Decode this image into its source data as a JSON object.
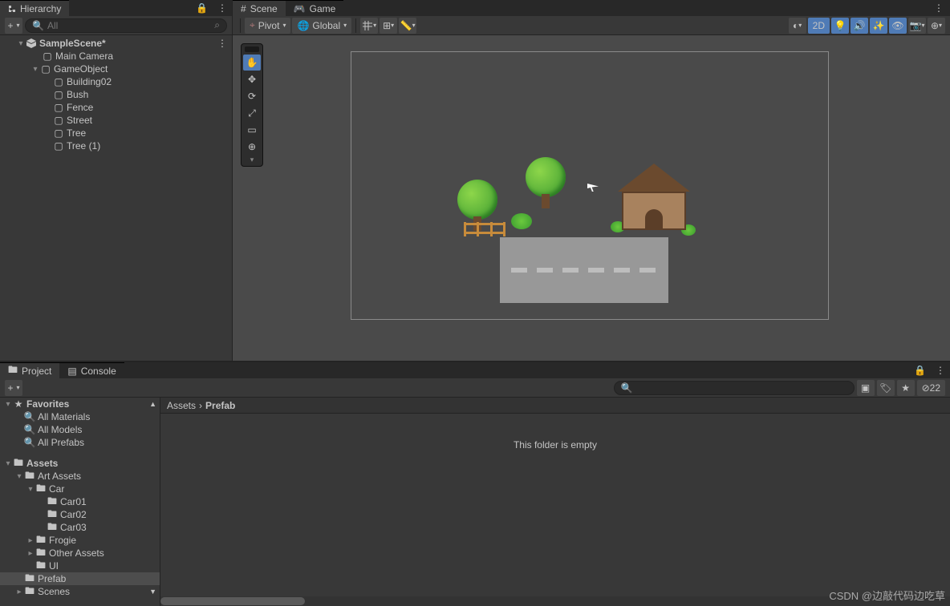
{
  "hierarchy": {
    "tab": "Hierarchy",
    "search_placeholder": "All",
    "scene": "SampleScene*",
    "items": [
      "Main Camera",
      "GameObject",
      "Building02",
      "Bush",
      "Fence",
      "Street",
      "Tree",
      "Tree (1)"
    ]
  },
  "scene": {
    "tab_scene": "Scene",
    "tab_game": "Game",
    "pivot": "Pivot",
    "global": "Global",
    "btn_2d": "2D"
  },
  "project": {
    "tab_project": "Project",
    "tab_console": "Console",
    "hidden_count": "22",
    "favorites": {
      "title": "Favorites",
      "items": [
        "All Materials",
        "All Models",
        "All Prefabs"
      ]
    },
    "assets": {
      "title": "Assets",
      "art": "Art Assets",
      "car": "Car",
      "cars": [
        "Car01",
        "Car02",
        "Car03"
      ],
      "frogie": "Frogie",
      "other": "Other Assets",
      "ui": "UI",
      "prefab": "Prefab",
      "scenes": "Scenes"
    },
    "breadcrumb": {
      "root": "Assets",
      "sub": "Prefab"
    },
    "empty": "This folder is empty"
  },
  "watermark": "CSDN @边敲代码边吃草"
}
